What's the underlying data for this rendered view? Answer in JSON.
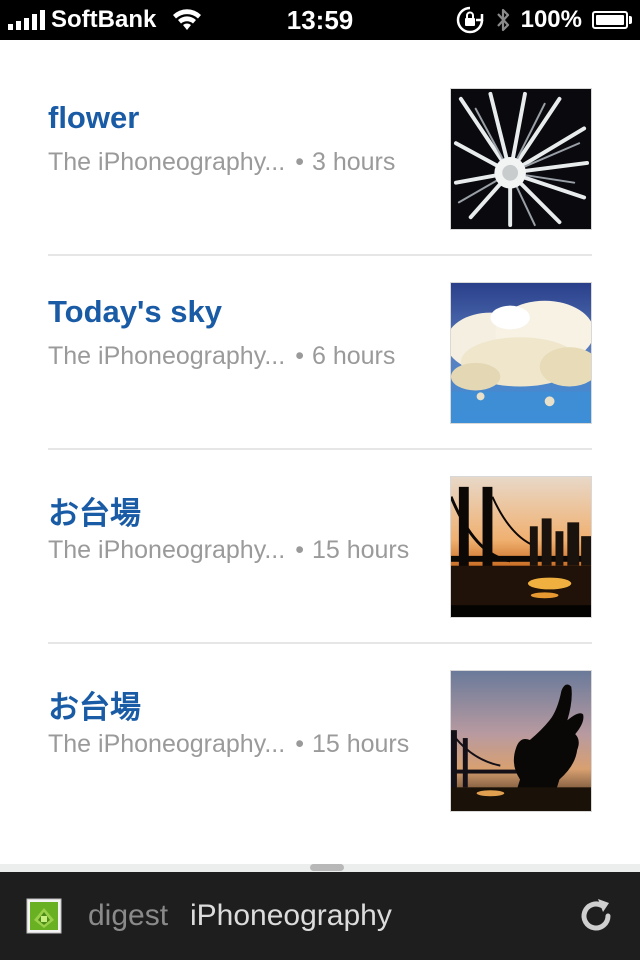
{
  "status_bar": {
    "carrier": "SoftBank",
    "time": "13:59",
    "battery": "100%",
    "battery_level": 1.0
  },
  "articles": [
    {
      "title": "flower",
      "source": "The iPhoneography...",
      "separator": "•",
      "age": "3 hours",
      "thumbnail": "flower-photo"
    },
    {
      "title": "Today's sky",
      "source": "The iPhoneography...",
      "separator": "•",
      "age": "6 hours",
      "thumbnail": "sky-photo"
    },
    {
      "title": "お台場",
      "source": "The iPhoneography...",
      "separator": "•",
      "age": "15 hours",
      "thumbnail": "bridge-sunset-photo"
    },
    {
      "title": "お台場",
      "source": "The iPhoneography...",
      "separator": "•",
      "age": "15 hours",
      "thumbnail": "hand-sunset-photo"
    }
  ],
  "bottom_bar": {
    "mode": "digest",
    "feed_name": "iPhoneography",
    "logo_icon": "feedly-logo-icon",
    "refresh_icon": "refresh-icon"
  },
  "colors": {
    "title": "#1a5ba6",
    "meta": "#9a9a9a",
    "bar": "#1e1e1e"
  }
}
